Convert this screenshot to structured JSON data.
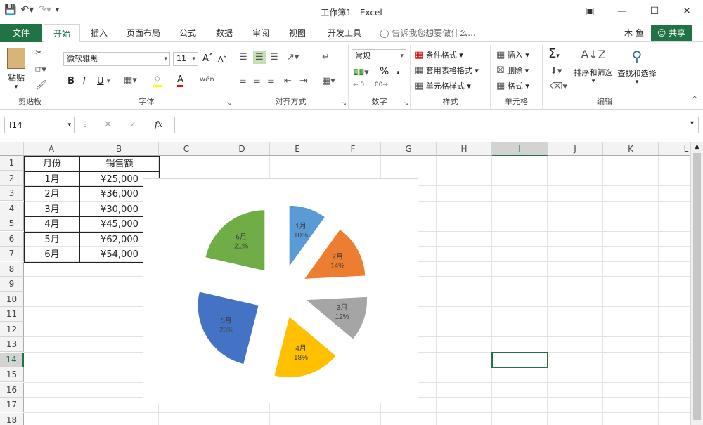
{
  "window": {
    "title": "工作簿1 - Excel"
  },
  "ribbon_tabs": [
    "文件",
    "开始",
    "插入",
    "页面布局",
    "公式",
    "数据",
    "审阅",
    "视图",
    "开发工具"
  ],
  "tell_me": "告诉我您想要做什么...",
  "user": "木 鱼",
  "share": "共享",
  "ribbon": {
    "clipboard": {
      "paste": "粘贴",
      "label": "剪贴板"
    },
    "font": {
      "name": "微软雅黑",
      "size": "11",
      "label": "字体",
      "bold": "B",
      "italic": "I",
      "underline": "U",
      "grow": "A",
      "shrink": "A"
    },
    "alignment": {
      "label": "对齐方式"
    },
    "number": {
      "format": "常规",
      "label": "数字",
      "percent": "%",
      "comma": ","
    },
    "styles": {
      "conditional": "条件格式",
      "table": "套用表格格式",
      "cell_styles": "单元格样式",
      "label": "样式"
    },
    "cells": {
      "insert": "插入",
      "delete": "删除",
      "format": "格式",
      "label": "单元格"
    },
    "editing": {
      "sort": "排序和筛选",
      "find": "查找和选择",
      "label": "编辑"
    }
  },
  "formula_bar": {
    "name_box": "I14",
    "fx": "fx",
    "value": ""
  },
  "columns": [
    "A",
    "B",
    "C",
    "D",
    "E",
    "F",
    "G",
    "H",
    "I",
    "J",
    "K",
    "L"
  ],
  "rows": [
    "1",
    "2",
    "3",
    "4",
    "5",
    "6",
    "7",
    "8",
    "9",
    "10",
    "11",
    "12",
    "13",
    "14",
    "15",
    "16",
    "17",
    "18"
  ],
  "selected": {
    "column": "I",
    "row": "14"
  },
  "table": {
    "headers": [
      "月份",
      "销售额"
    ],
    "rows": [
      [
        "1月",
        "¥25,000"
      ],
      [
        "2月",
        "¥36,000"
      ],
      [
        "3月",
        "¥30,000"
      ],
      [
        "4月",
        "¥45,000"
      ],
      [
        "5月",
        "¥62,000"
      ],
      [
        "6月",
        "¥54,000"
      ]
    ]
  },
  "chart_data": {
    "type": "pie",
    "exploded": true,
    "categories": [
      "1月",
      "2月",
      "3月",
      "4月",
      "5月",
      "6月"
    ],
    "values": [
      25000,
      36000,
      30000,
      45000,
      62000,
      54000
    ],
    "labels": [
      "10%",
      "14%",
      "12%",
      "18%",
      "25%",
      "21%"
    ],
    "colors": [
      "#5b9bd5",
      "#ed7d31",
      "#a5a5a5",
      "#ffc000",
      "#4472c4",
      "#70ad47"
    ]
  }
}
